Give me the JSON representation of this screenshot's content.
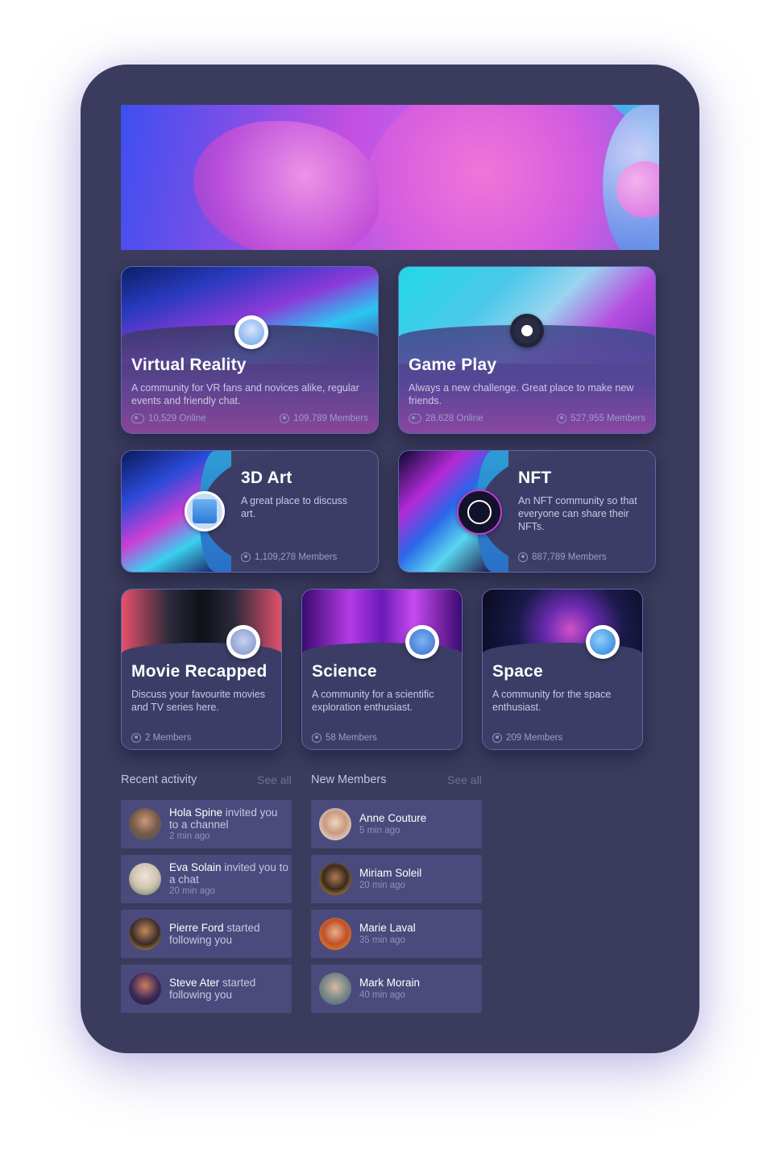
{
  "colors": {
    "device_bg": "#3a3b5d",
    "card_bg": "#3f4068",
    "row_bg": "#4a4b7c",
    "accent_blue": "#2e9cd6",
    "accent_purple": "#9b5ee6"
  },
  "communities": [
    {
      "title": "Virtual Reality",
      "description": "A community for VR  fans and novices alike, regular events and friendly chat.",
      "online": "10,529 Online",
      "members": "109,789 Members",
      "icon": "vr-headset-icon"
    },
    {
      "title": "Game Play",
      "description": "Always a new challenge. Great place to make new friends.",
      "online": "28,628 Online",
      "members": "527,955 Members",
      "icon": "gamepad-icon"
    },
    {
      "title": "3D Art",
      "description": "A great place to discuss art.",
      "members": "1,109,278 Members",
      "icon": "3d-figure-icon"
    },
    {
      "title": "NFT",
      "description": "An NFT community so that everyone can share their NFTs.",
      "members": "887,789 Members",
      "icon": "vitruvian-icon"
    },
    {
      "title": "Movie Recapped",
      "description": "Discuss your favourite movies and TV series here.",
      "members": "2 Members",
      "icon": "movie-viewer-icon"
    },
    {
      "title": "Science",
      "description": "A community for a scientific exploration enthusiast.",
      "members": "58 Members",
      "icon": "science-laptop-icon"
    },
    {
      "title": "Space",
      "description": "A community for the space enthusiast.",
      "members": "209 Members",
      "icon": "globe-icon"
    }
  ],
  "recent_activity": {
    "label": "Recent activity",
    "see_all": "See all",
    "items": [
      {
        "name": "Hola Spine",
        "action": " invited you to a channel",
        "time": "2 min ago"
      },
      {
        "name": "Eva Solain",
        "action": " invited you to a chat",
        "time": "20 min ago"
      },
      {
        "name": "Pierre Ford",
        "action": " started following you",
        "time": ""
      },
      {
        "name": "Steve Ater",
        "action": " started following you",
        "time": ""
      }
    ]
  },
  "new_members": {
    "label": "New Members",
    "see_all": "See all",
    "items": [
      {
        "name": "Anne Couture",
        "time": "5 min ago"
      },
      {
        "name": "Miriam Soleil",
        "time": "20 min ago"
      },
      {
        "name": "Marie Laval",
        "time": "35 min ago"
      },
      {
        "name": "Mark  Morain",
        "time": "40 min ago"
      }
    ]
  }
}
